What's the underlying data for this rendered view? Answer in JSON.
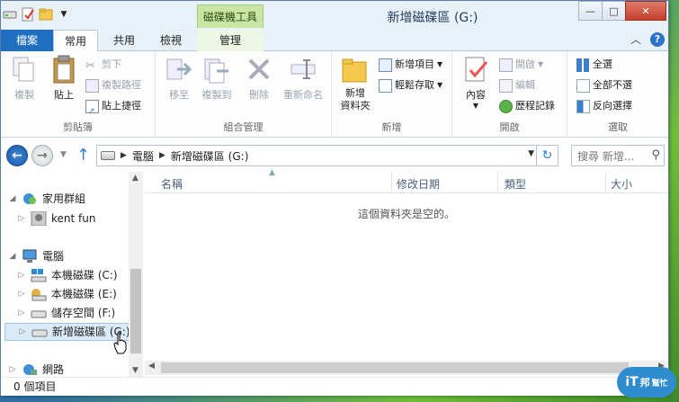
{
  "window": {
    "title": "新增磁碟區 (G:)",
    "context_tab_header": "磁碟機工具",
    "buttons": {
      "minimize": "—",
      "maximize": "□",
      "close": "✕"
    }
  },
  "ribbon_tabs": [
    "檔案",
    "常用",
    "共用",
    "檢視",
    "管理"
  ],
  "ribbon": {
    "clipboard": {
      "label": "剪貼簿",
      "copy": "複製",
      "paste": "貼上",
      "cut": "剪下",
      "copy_path": "複製路徑",
      "paste_shortcut": "貼上捷徑"
    },
    "organize": {
      "label": "組合管理",
      "move_to": "移至",
      "copy_to": "複製到",
      "delete": "刪除",
      "rename": "重新命名"
    },
    "new": {
      "label": "新增",
      "new_folder_line1": "新增",
      "new_folder_line2": "資料夾",
      "new_item": "新增項目",
      "easy_access": "輕鬆存取"
    },
    "open": {
      "label": "開啟",
      "properties": "內容",
      "open": "開啟",
      "edit": "編輯",
      "history": "歷程記錄"
    },
    "select": {
      "label": "選取",
      "select_all": "全選",
      "select_none": "全部不選",
      "invert": "反向選擇"
    }
  },
  "address": {
    "crumbs": [
      "電腦",
      "新增磁碟區 (G:)"
    ],
    "search_placeholder": "搜尋 新增..."
  },
  "nav": {
    "homegroup": "家用群組",
    "user": "kent fun",
    "computer": "電腦",
    "drive_c": "本機磁碟 (C:)",
    "drive_e": "本機磁碟 (E:)",
    "drive_f": "儲存空間 (F:)",
    "drive_g": "新增磁碟區 (G:)",
    "network": "網路"
  },
  "columns": [
    "名稱",
    "修改日期",
    "類型",
    "大小"
  ],
  "empty_message": "這個資料夾是空的。",
  "status": "0 個項目",
  "watermark": {
    "big": "iT",
    "small1": "邦",
    "small2": "幫忙"
  },
  "colors": {
    "accent": "#1e6fc1",
    "context_tab": "#c9e7a4"
  }
}
